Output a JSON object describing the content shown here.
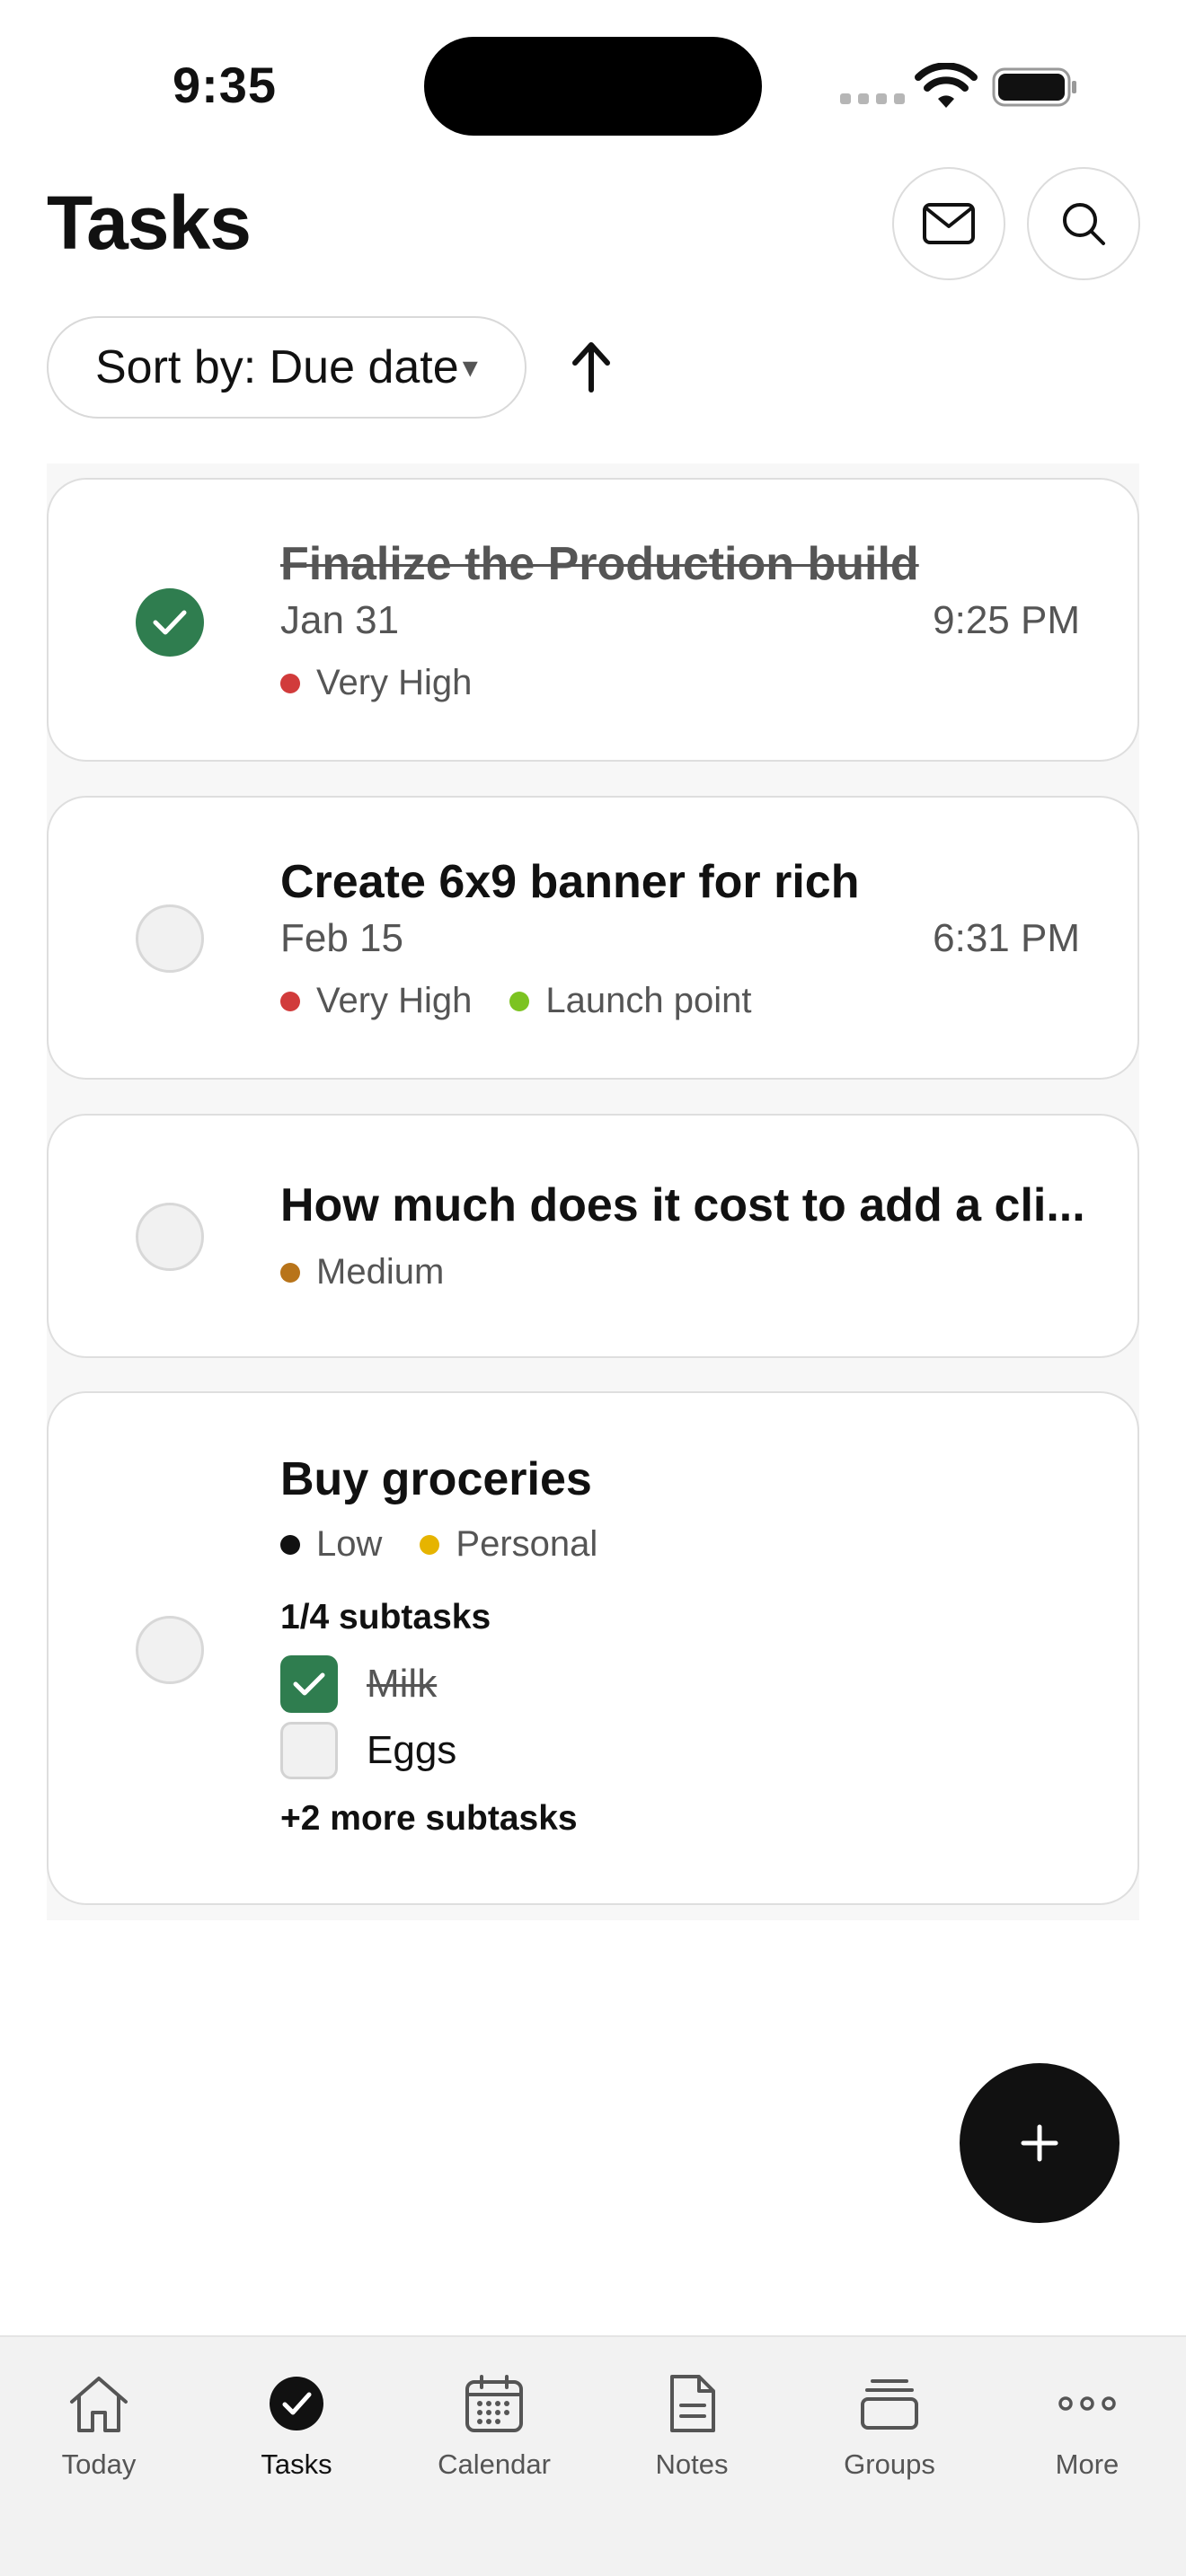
{
  "status_bar": {
    "time": "9:35"
  },
  "header": {
    "title": "Tasks"
  },
  "sort": {
    "label": "Sort by: Due date",
    "caret": "▾"
  },
  "tasks": [
    {
      "title": "Finalize the Production build",
      "date": "Jan 31",
      "time": "9:25 PM",
      "completed": true,
      "tags": [
        {
          "label": "Very High",
          "color": "#d13b3b"
        }
      ]
    },
    {
      "title": "Create 6x9 banner for rich",
      "date": "Feb 15",
      "time": "6:31 PM",
      "completed": false,
      "tags": [
        {
          "label": "Very High",
          "color": "#d13b3b"
        },
        {
          "label": "Launch point",
          "color": "#7cc321"
        }
      ]
    },
    {
      "title": "How much does it cost to add a cli...",
      "completed": false,
      "tags": [
        {
          "label": "Medium",
          "color": "#b8741a"
        }
      ]
    },
    {
      "title": "Buy groceries",
      "completed": false,
      "tags": [
        {
          "label": "Low",
          "color": "#111111"
        },
        {
          "label": "Personal",
          "color": "#e6b400"
        }
      ],
      "subtask_count": "1/4 subtasks",
      "subtasks": [
        {
          "label": "Milk",
          "completed": true
        },
        {
          "label": "Eggs",
          "completed": false
        }
      ],
      "more_subtasks": "+2 more subtasks"
    }
  ],
  "fab": {
    "icon": "plus-icon"
  },
  "tab_bar": [
    {
      "label": "Today",
      "icon": "house-icon",
      "active": false
    },
    {
      "label": "Tasks",
      "icon": "check-circle-icon",
      "active": true
    },
    {
      "label": "Calendar",
      "icon": "calendar-icon",
      "active": false
    },
    {
      "label": "Notes",
      "icon": "document-icon",
      "active": false
    },
    {
      "label": "Groups",
      "icon": "stack-icon",
      "active": false
    },
    {
      "label": "More",
      "icon": "ellipsis-icon",
      "active": false
    }
  ],
  "colors": {
    "accent_green": "#2f7d4f",
    "fab": "#111111"
  }
}
